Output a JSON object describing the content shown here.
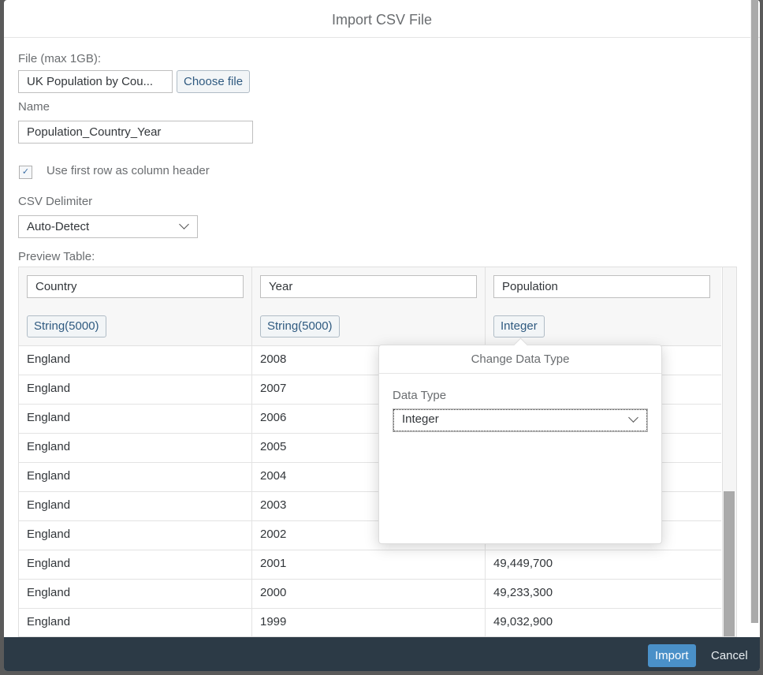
{
  "dialog": {
    "title": "Import CSV File"
  },
  "file": {
    "label": "File (max 1GB):",
    "value": "UK Population by Cou...",
    "choose_label": "Choose file"
  },
  "name": {
    "label": "Name",
    "value": "Population_Country_Year"
  },
  "header_checkbox": {
    "label": "Use first row as column header",
    "checked": true
  },
  "delimiter": {
    "label": "CSV Delimiter",
    "value": "Auto-Detect"
  },
  "preview": {
    "label": "Preview Table:",
    "columns": [
      {
        "name": "Country",
        "type": "String(5000)"
      },
      {
        "name": "Year",
        "type": "String(5000)"
      },
      {
        "name": "Population",
        "type": "Integer"
      }
    ],
    "rows": [
      [
        "England",
        "2008",
        ""
      ],
      [
        "England",
        "2007",
        ""
      ],
      [
        "England",
        "2006",
        ""
      ],
      [
        "England",
        "2005",
        ""
      ],
      [
        "England",
        "2004",
        ""
      ],
      [
        "England",
        "2003",
        ""
      ],
      [
        "England",
        "2002",
        ""
      ],
      [
        "England",
        "2001",
        "49,449,700"
      ],
      [
        "England",
        "2000",
        "49,233,300"
      ],
      [
        "England",
        "1999",
        "49,032,900"
      ]
    ]
  },
  "popover": {
    "title": "Change Data Type",
    "field_label": "Data Type",
    "value": "Integer"
  },
  "footer": {
    "import_label": "Import",
    "cancel_label": "Cancel"
  }
}
